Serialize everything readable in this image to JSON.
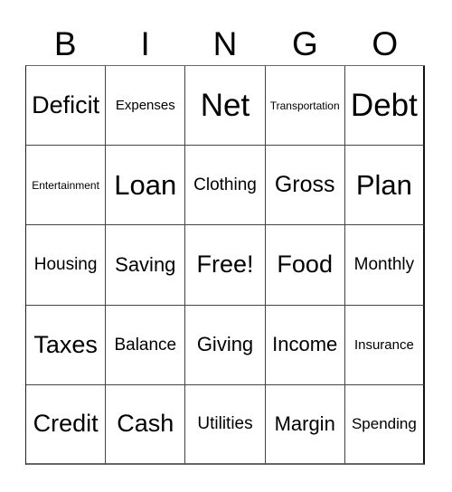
{
  "card": {
    "header": [
      "B",
      "I",
      "N",
      "G",
      "O"
    ],
    "rows": [
      [
        "Deficit",
        "Expenses",
        "Net",
        "Transportation",
        "Debt"
      ],
      [
        "Entertainment",
        "Loan",
        "Clothing",
        "Gross",
        "Plan"
      ],
      [
        "Housing",
        "Saving",
        "Free!",
        "Food",
        "Monthly"
      ],
      [
        "Taxes",
        "Balance",
        "Giving",
        "Income",
        "Insurance"
      ],
      [
        "Credit",
        "Cash",
        "Utilities",
        "Margin",
        "Spending"
      ]
    ]
  }
}
